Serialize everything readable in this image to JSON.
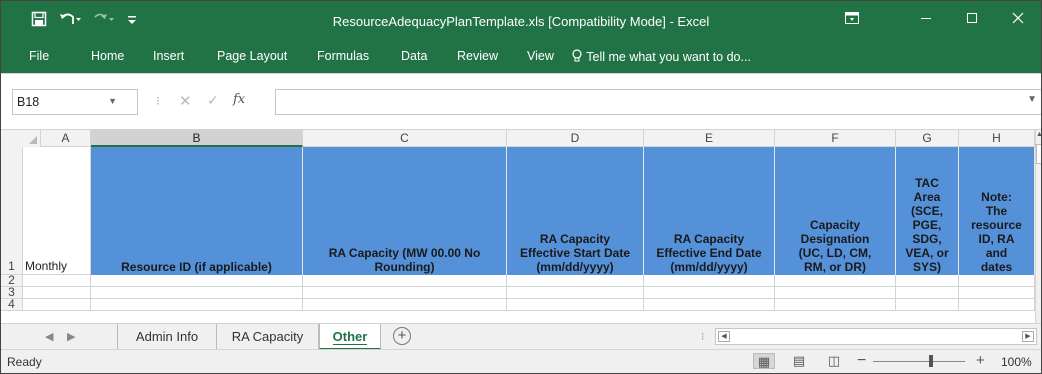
{
  "window": {
    "title": "ResourceAdequacyPlanTemplate.xls  [Compatibility Mode] - Excel",
    "qat_icons": [
      "save-icon",
      "undo-icon",
      "redo-icon",
      "customize-icon"
    ],
    "controls": [
      "ribbon-options-icon",
      "minimize-icon",
      "maximize-icon",
      "close-icon"
    ]
  },
  "ribbon": {
    "tabs": [
      "File",
      "Home",
      "Insert",
      "Page Layout",
      "Formulas",
      "Data",
      "Review",
      "View"
    ],
    "tell_me": "Tell me what you want to do..."
  },
  "formula_bar": {
    "name_box": "B18",
    "fx": "fx",
    "content": ""
  },
  "grid": {
    "columns": [
      "A",
      "B",
      "C",
      "D",
      "E",
      "F",
      "G",
      "H"
    ],
    "selected_column": "B",
    "rows": [
      "1",
      "2",
      "3",
      "4"
    ],
    "row1": {
      "A": "Monthly",
      "B": "Resource ID (if applicable)",
      "C": "RA Capacity (MW 00.00 No\nRounding)",
      "D": "RA Capacity\nEffective Start Date\n(mm/dd/yyyy)",
      "E": "RA Capacity\nEffective End Date\n(mm/dd/yyyy)",
      "F": "Capacity\nDesignation\n(UC, LD, CM,\nRM, or DR)",
      "G": "TAC\nArea\n(SCE,\nPGE,\nSDG,\nVEA, or\nSYS)",
      "H": "Note:\nThe\nresource\nID, RA\nand\ndates"
    },
    "header_fill": "#5591D9"
  },
  "sheets": {
    "tabs": [
      "Admin Info",
      "RA Capacity",
      "Other"
    ],
    "active": "Other"
  },
  "status": {
    "text": "Ready",
    "zoom": "100%"
  },
  "colors": {
    "excel_green": "#217346"
  }
}
